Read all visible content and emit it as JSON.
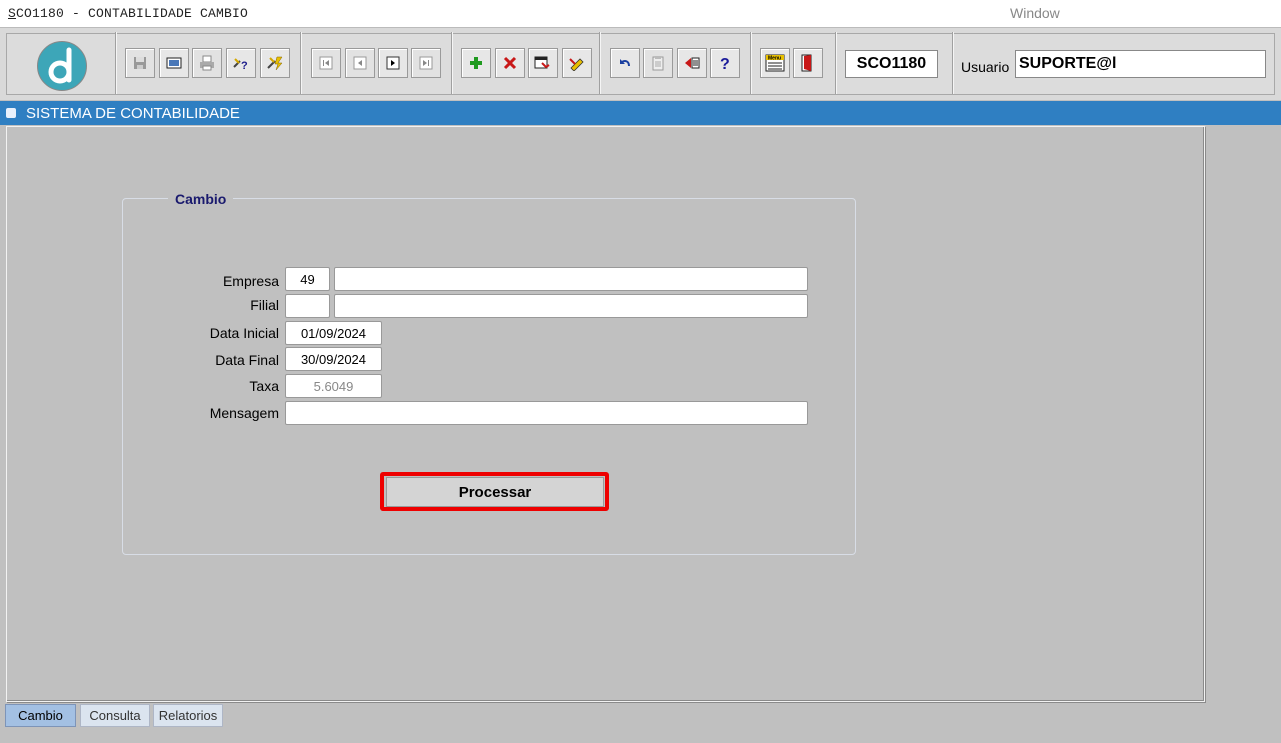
{
  "app": {
    "title_prefix": "S",
    "title_rest": "CO1180 - CONTABILIDADE CAMBIO",
    "window_menu": "Window"
  },
  "toolbar": {
    "form_code": "SCO1180",
    "usuario_label": "Usuario",
    "usuario_value": "SUPORTE@l",
    "buttons": [
      {
        "name": "save-icon"
      },
      {
        "name": "print-preview-icon"
      },
      {
        "name": "print-icon"
      },
      {
        "name": "query-help-icon"
      },
      {
        "name": "execute-query-icon"
      },
      {
        "name": "first-record-icon"
      },
      {
        "name": "previous-record-icon"
      },
      {
        "name": "next-record-icon"
      },
      {
        "name": "last-record-icon"
      },
      {
        "name": "insert-record-icon"
      },
      {
        "name": "delete-record-icon"
      },
      {
        "name": "edit-record-icon"
      },
      {
        "name": "clear-record-icon"
      },
      {
        "name": "undo-icon"
      },
      {
        "name": "clipboard-icon"
      },
      {
        "name": "list-of-values-icon"
      },
      {
        "name": "help-icon"
      },
      {
        "name": "menu-icon"
      },
      {
        "name": "exit-icon"
      }
    ]
  },
  "system_bar": {
    "title": "SISTEMA DE CONTABILIDADE"
  },
  "form": {
    "group_title": "Cambio",
    "empresa_label": "Empresa",
    "empresa_code": "49",
    "empresa_name": "",
    "filial_label": "Filial",
    "filial_code": "",
    "filial_name": "",
    "data_inicial_label": "Data Inicial",
    "data_inicial": "01/09/2024",
    "data_final_label": "Data Final",
    "data_final": "30/09/2024",
    "taxa_label": "Taxa",
    "taxa": "5.6049",
    "mensagem_label": "Mensagem",
    "mensagem": "",
    "processar_label": "Processar"
  },
  "tabs": [
    {
      "label": "Cambio",
      "active": true
    },
    {
      "label": "Consulta",
      "active": false
    },
    {
      "label": "Relatorios",
      "active": false
    }
  ],
  "colors": {
    "system_bar": "#2f7fc2",
    "highlight": "#ee0000",
    "background": "#c0c0c0"
  }
}
